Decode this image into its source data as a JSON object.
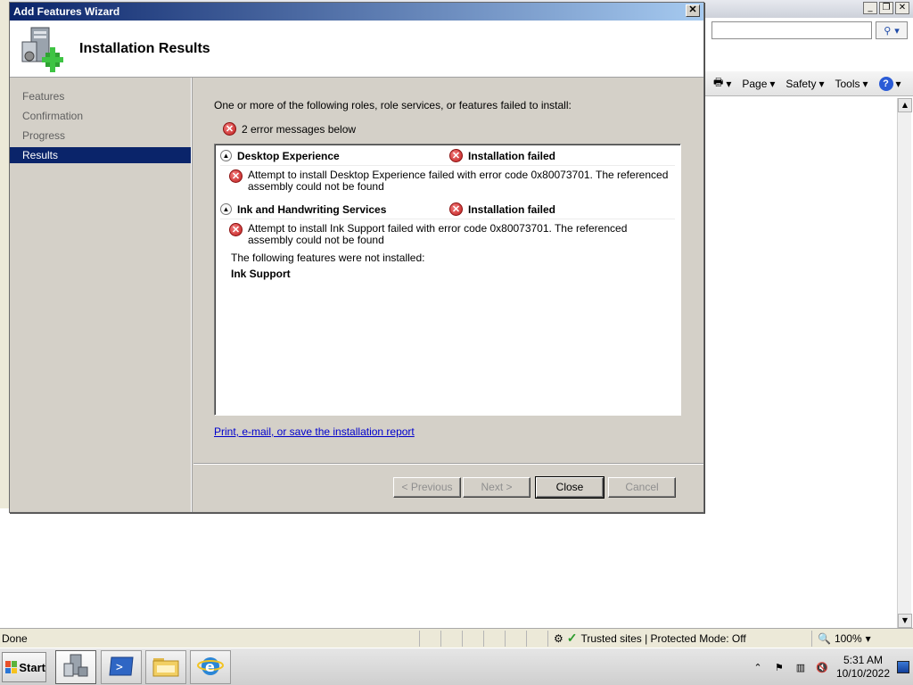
{
  "ie": {
    "status_text": "Done",
    "zone_text": "Trusted sites | Protected Mode: Off",
    "zoom": "100%",
    "commands": [
      {
        "label": "Page"
      },
      {
        "label": "Safety"
      },
      {
        "label": "Tools"
      }
    ]
  },
  "wizard": {
    "title": "Add Features Wizard",
    "header_title": "Installation Results",
    "nav": [
      {
        "label": "Features",
        "active": false
      },
      {
        "label": "Confirmation",
        "active": false
      },
      {
        "label": "Progress",
        "active": false
      },
      {
        "label": "Results",
        "active": true
      }
    ],
    "intro_text": "One or more of the following roles, role services, or features failed to install:",
    "summary_text": "2 error messages below",
    "results": [
      {
        "name": "Desktop Experience",
        "status": "Installation failed",
        "message": "Attempt to install Desktop Experience failed with error code 0x80073701.  The referenced assembly could not be found"
      },
      {
        "name": "Ink and Handwriting Services",
        "status": "Installation failed",
        "message": "Attempt to install Ink Support failed with error code 0x80073701.  The referenced assembly could not be found",
        "not_installed_label": "The following features were not installed:",
        "not_installed_feature": "Ink Support"
      }
    ],
    "report_link": "Print, e-mail, or save the installation report",
    "buttons": {
      "previous": "< Previous",
      "next": "Next >",
      "close": "Close",
      "cancel": "Cancel"
    }
  },
  "taskbar": {
    "start_label": "Start",
    "clock_time": "5:31 AM",
    "clock_date": "10/10/2022"
  },
  "colors": {
    "titlebar_start": "#0a246a",
    "titlebar_end": "#a6caf0",
    "nav_active": "#0a246a",
    "error_red": "#c01f1f",
    "link": "#0000cc"
  }
}
